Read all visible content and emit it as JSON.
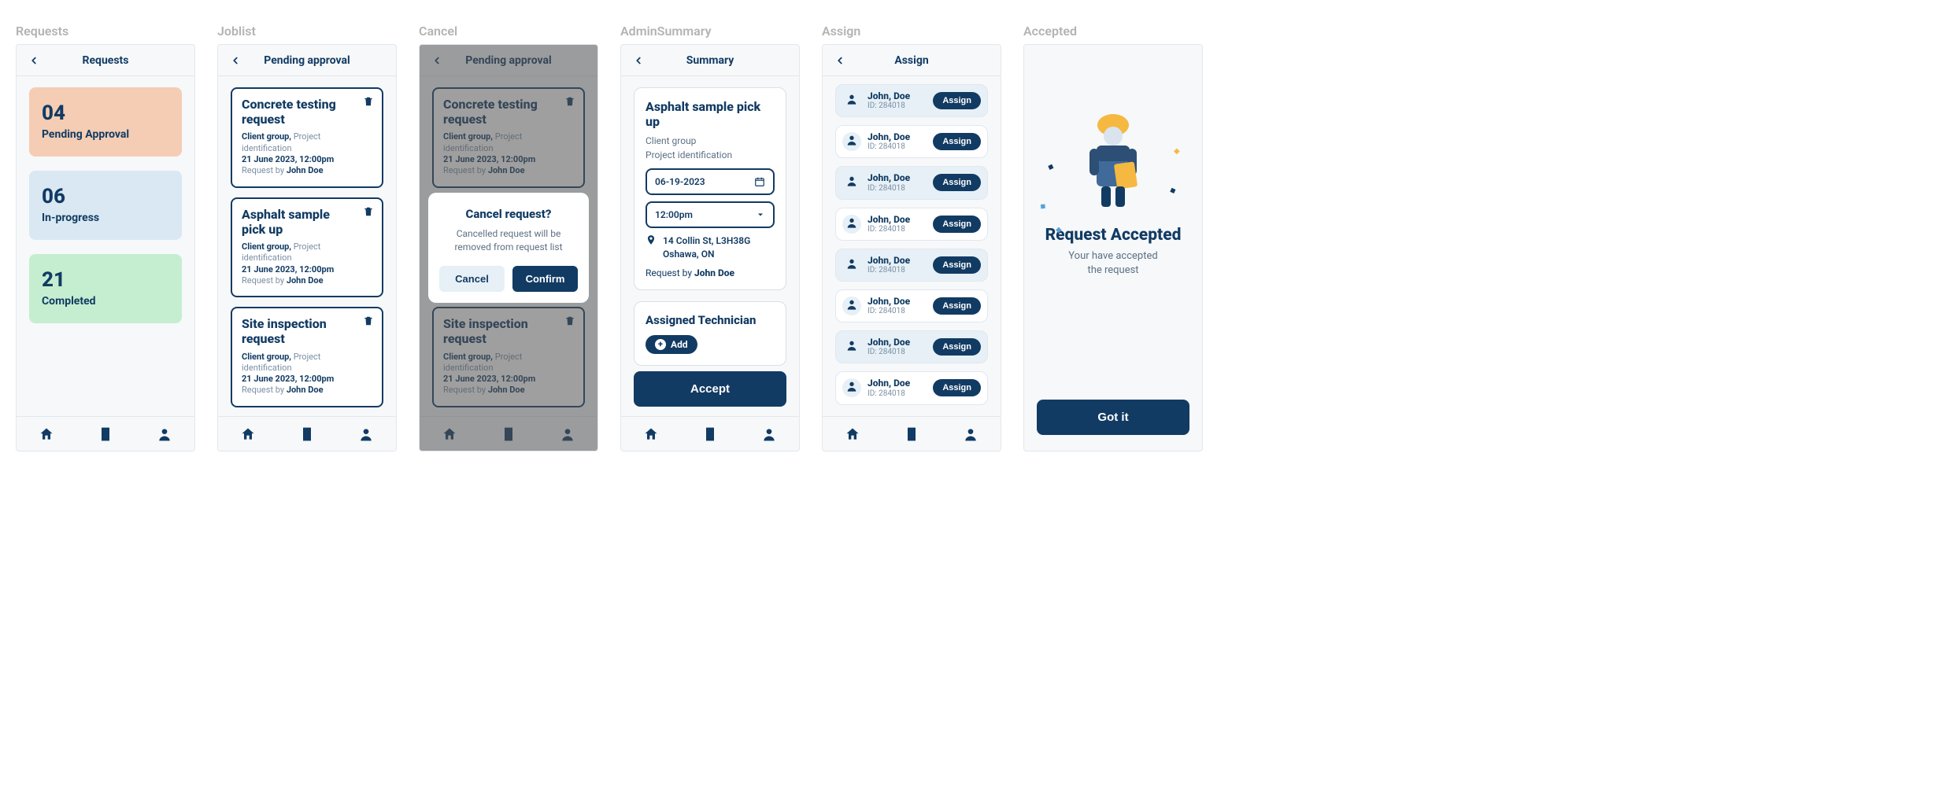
{
  "frames": {
    "requests": {
      "label": "Requests",
      "title": "Requests"
    },
    "joblist": {
      "label": "Joblist",
      "title": "Pending approval"
    },
    "cancel": {
      "label": "Cancel",
      "title": "Pending approval"
    },
    "adminSummary": {
      "label": "AdminSummary",
      "title": "Summary"
    },
    "assign": {
      "label": "Assign",
      "title": "Assign"
    },
    "accepted": {
      "label": "Accepted",
      "title": ""
    }
  },
  "stats": {
    "pending": {
      "num": "04",
      "label": "Pending Approval"
    },
    "progress": {
      "num": "06",
      "label": "In-progress"
    },
    "completed": {
      "num": "21",
      "label": "Completed"
    }
  },
  "job_common": {
    "client": "Client group,",
    "project": "Project identification",
    "date": "21 June 2023, 12:00pm",
    "request_by": "Request by",
    "requester": "John Doe"
  },
  "jobs": [
    {
      "title": "Concrete testing request"
    },
    {
      "title": "Asphalt sample pick up"
    },
    {
      "title": "Site inspection request"
    },
    {
      "title": "Site inspection request"
    }
  ],
  "cancelDialog": {
    "title": "Cancel request?",
    "message": "Cancelled request will be removed from request list",
    "cancel": "Cancel",
    "confirm": "Confirm"
  },
  "summary": {
    "title": "Asphalt sample pick up",
    "client": "Client group",
    "project": "Project identification",
    "date": "06-19-2023",
    "time": "12:00pm",
    "addr1": "14 Collin St, L3H38G",
    "addr2": "Oshawa, ON",
    "request_by": "Request by",
    "requester": "John Doe",
    "tech_label": "Assigned Technician",
    "add": "Add",
    "accept": "Accept"
  },
  "assignList": {
    "name": "John, Doe",
    "id": "ID: 284018",
    "btn": "Assign"
  },
  "accepted": {
    "title": "Request Accepted",
    "msg1": "Your have accepted",
    "msg2": "the request",
    "gotit": "Got it"
  }
}
